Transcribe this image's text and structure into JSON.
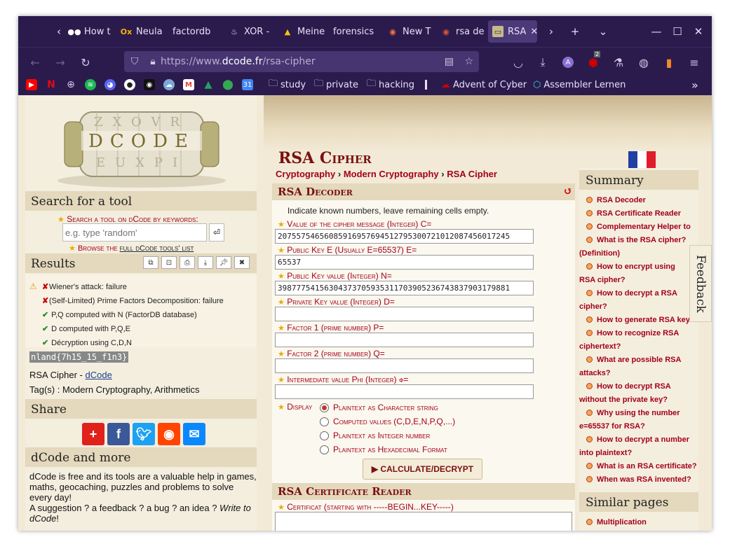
{
  "browser": {
    "tabs": [
      {
        "label": "How t",
        "icon": "medium-icon"
      },
      {
        "label": "Neula",
        "icon": "ox-icon"
      },
      {
        "label": "factordb",
        "icon": "factordb-icon"
      },
      {
        "label": "XOR -",
        "icon": "chef-icon"
      },
      {
        "label": "Meine",
        "icon": "drive-icon"
      },
      {
        "label": "forensics",
        "icon": "blank-icon"
      },
      {
        "label": "New T",
        "icon": "firefox-icon"
      },
      {
        "label": "rsa de",
        "icon": "duckduckgo-icon"
      },
      {
        "label": "RSA",
        "icon": "dcode-icon",
        "active": true
      }
    ],
    "url": {
      "prefix": "https://www.",
      "host": "dcode.fr",
      "path": "/rsa-cipher"
    },
    "toolbar_badge": "2",
    "profile_letter": "A",
    "bookmarks": [
      {
        "label": "",
        "icon": "youtube-icon",
        "color": "#ff0000"
      },
      {
        "label": "",
        "icon": "netflix-icon",
        "color": "#e50914"
      },
      {
        "label": "",
        "icon": "globe-icon",
        "color": "#6b5fa0"
      },
      {
        "label": "",
        "icon": "spotify-icon",
        "color": "#1db954"
      },
      {
        "label": "",
        "icon": "discord-icon",
        "color": "#5865f2"
      },
      {
        "label": "",
        "icon": "github-icon",
        "color": "#333333"
      },
      {
        "label": "",
        "icon": "eye-icon",
        "color": "#444444"
      },
      {
        "label": "",
        "icon": "cloud-icon",
        "color": "#7aa7d8"
      },
      {
        "label": "",
        "icon": "gmail-icon",
        "color": "#ea4335"
      },
      {
        "label": "",
        "icon": "drive-icon",
        "color": "#1fa463"
      },
      {
        "label": "",
        "icon": "maps-icon",
        "color": "#34a853"
      },
      {
        "label": "",
        "icon": "calendar-icon",
        "color": "#4285f4"
      },
      {
        "label": "study",
        "icon": "folder-icon"
      },
      {
        "label": "private",
        "icon": "folder-icon"
      },
      {
        "label": "hacking",
        "icon": "folder-icon"
      },
      {
        "label": "Advent of Cyber",
        "icon": "thm-icon"
      },
      {
        "label": "Assembler Lernen",
        "icon": "assembler-icon"
      }
    ]
  },
  "left": {
    "logo_text": "DCODE",
    "search": {
      "heading": "Search for a tool",
      "by_keywords": "Search a tool on dCode by keywords:",
      "placeholder": "e.g. type 'random'",
      "enter_glyph": "⏎",
      "browse_prefix": "Browse the",
      "browse_link": "full dCode tools' list"
    },
    "results": {
      "heading": "Results",
      "lines": [
        "Wiener's attack: failure",
        "(Self-Limited) Prime Factors Decomposition: failure",
        "P,Q computed with N (FactorDB database)",
        "D computed with P,Q,E",
        "Décryption using C,D,N"
      ],
      "flag_output": "nland{7h15_15_f1n3}",
      "source_prefix": "RSA Cipher - ",
      "source_link": "dCode",
      "tags_label": "Tag(s) : ",
      "tags": "Modern Cryptography, Arithmetics"
    },
    "share": {
      "heading": "Share"
    },
    "more": {
      "heading": "dCode and more",
      "text": "dCode is free and its tools are a valuable help in games, maths, geocaching, puzzles and problems to solve every day!",
      "suggestion": "A suggestion ? a feedback ? a bug ? an idea ? ",
      "write_link": "Write to dCode",
      "write_end": "!"
    }
  },
  "main": {
    "title": "RSA Cipher",
    "breadcrumb": [
      "Cryptography",
      "Modern Cryptography",
      "RSA Cipher"
    ],
    "crumb_sep": "›",
    "decoder": {
      "heading": "RSA Decoder",
      "intro": "Indicate known numbers, leave remaining cells empty.",
      "fields": [
        {
          "label": "Value of the cipher message (Integer) C=",
          "value": "20755754656085916957694512795300721012087456017245"
        },
        {
          "label": "Public Key E (Usually E=65537) E=",
          "value": "65537"
        },
        {
          "label": "Public Key value (Integer) N=",
          "value": "39877754156304373705935311703905236743837903179881"
        },
        {
          "label": "Private Key value (Integer) D=",
          "value": ""
        },
        {
          "label": "Factor 1 (prime number) P=",
          "value": ""
        },
        {
          "label": "Factor 2 (prime number) Q=",
          "value": ""
        },
        {
          "label": "Intermediate value Phi (Integer) φ=",
          "value": ""
        }
      ],
      "display_label": "Display",
      "display_options": [
        {
          "label": "Plaintext as Character string",
          "selected": true
        },
        {
          "label": "Computed values (C,D,E,N,P,Q,...)",
          "selected": false
        },
        {
          "label": "Plaintext as Integer number",
          "selected": false
        },
        {
          "label": "Plaintext as Hexadecimal Format",
          "selected": false
        }
      ],
      "calc_button": "▶ CALCULATE/DECRYPT"
    },
    "cert": {
      "heading": "RSA Certificate Reader",
      "label": "Certificat (starting with -----BEGIN...KEY-----)"
    }
  },
  "summary": {
    "heading": "Summary",
    "items": [
      "RSA Decoder",
      "RSA Certificate Reader",
      "Complementary Helper to",
      "What is the RSA cipher? (Definition)",
      "How to encrypt using RSA cipher?",
      "How to decrypt a RSA cipher?",
      "How to generate RSA keys?",
      "How to recognize RSA ciphertext?",
      "What are possible RSA attacks?",
      "How to decrypt RSA without the private key?",
      "Why using the number e=65537 for RSA?",
      "How to decrypt a number into plaintext?",
      "What is an RSA certificate?",
      "When was RSA invented?"
    ],
    "similar_heading": "Similar pages",
    "similar_items": [
      "Multiplication"
    ]
  },
  "feedback_label": "Feedback"
}
